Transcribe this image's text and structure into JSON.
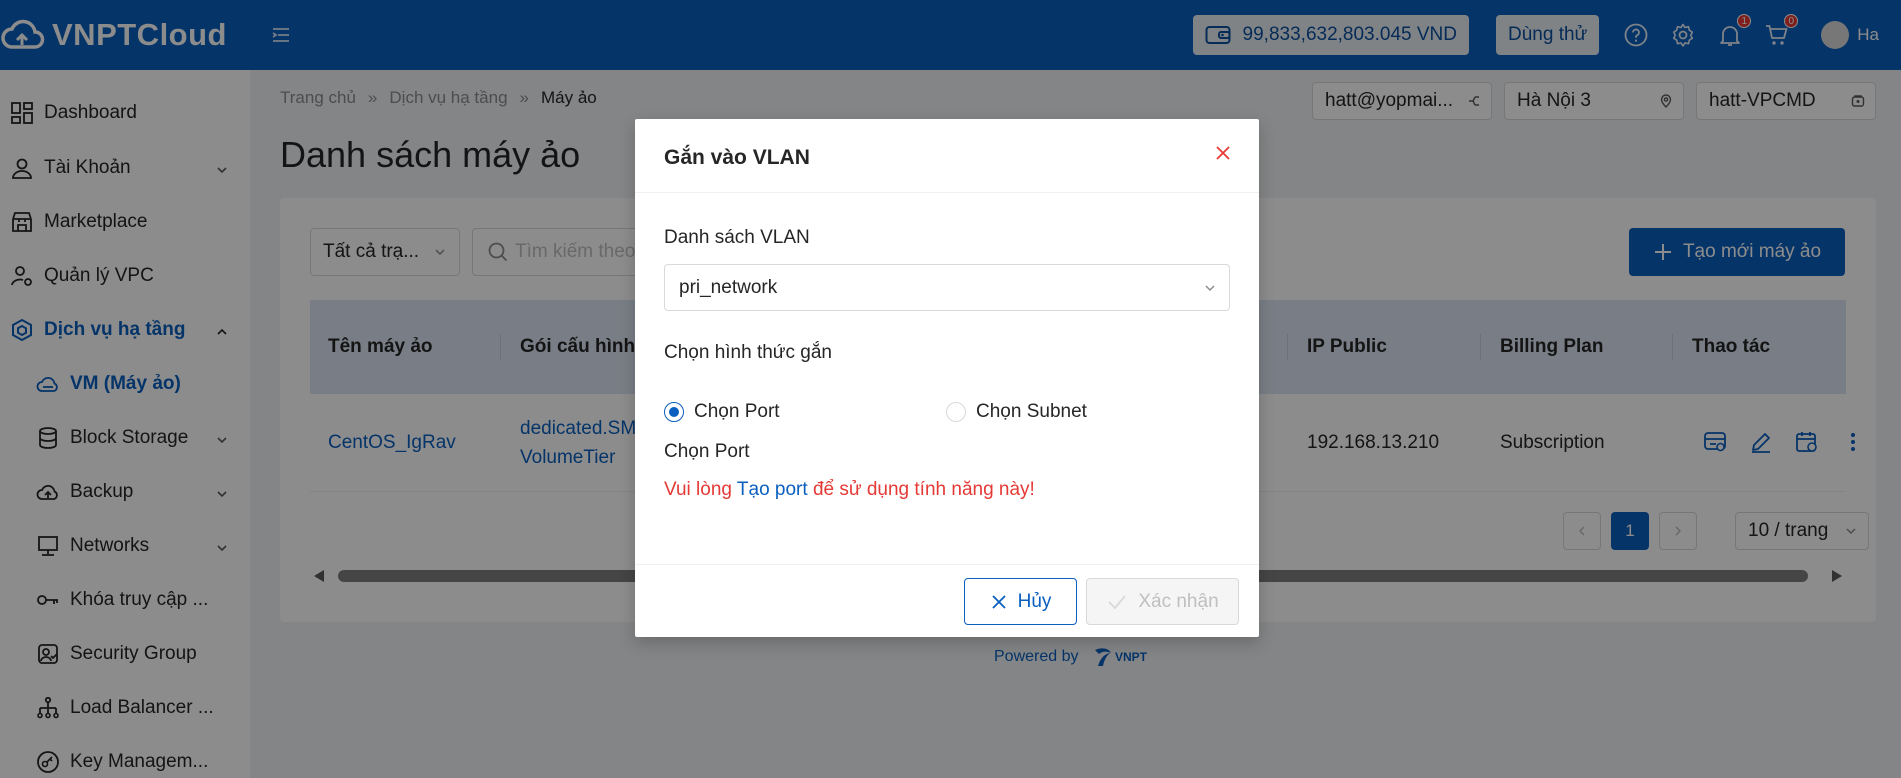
{
  "app": {
    "brand": "VNPTCloud",
    "colors": {
      "primary": "#0a5fbf",
      "danger": "#e53935",
      "header": "#0a5fbf"
    }
  },
  "header": {
    "balance": "99,833,632,803.045 VND",
    "trial_label": "Dùng thử",
    "notifications_count": "1",
    "cart_count": "0",
    "user_name": "Ha"
  },
  "sidebar": {
    "items": [
      {
        "label": "Dashboard",
        "icon": "dashboard-icon"
      },
      {
        "label": "Tài Khoản",
        "icon": "user-icon"
      },
      {
        "label": "Marketplace",
        "icon": "store-icon"
      },
      {
        "label": "Quản lý VPC",
        "icon": "user-settings-icon"
      },
      {
        "label": "Dịch vụ hạ tầng",
        "icon": "cube-icon"
      },
      {
        "label": "VM (Máy ảo)",
        "icon": "cloud-icon"
      },
      {
        "label": "Block Storage",
        "icon": "database-icon"
      },
      {
        "label": "Backup",
        "icon": "cloud-upload-icon"
      },
      {
        "label": "Networks",
        "icon": "monitor-icon"
      },
      {
        "label": "Khóa truy cập ...",
        "icon": "key-icon"
      },
      {
        "label": "Security Group",
        "icon": "security-icon"
      },
      {
        "label": "Load Balancer ...",
        "icon": "sitemap-icon"
      },
      {
        "label": "Key Managem...",
        "icon": "key-circle-icon"
      }
    ]
  },
  "breadcrumb": {
    "home": "Trang chủ",
    "parent": "Dịch vụ hạ tầng",
    "current": "Máy ảo",
    "separator": "»"
  },
  "context": {
    "account": "hatt@yopmai...",
    "region": "Hà Nội 3",
    "vpc": "hatt-VPCMD"
  },
  "page": {
    "title": "Danh sách máy ảo",
    "filter_value": "Tất cả trạ...",
    "search_placeholder": "Tìm kiếm theo",
    "create_label": "Tạo mới máy ảo"
  },
  "table": {
    "columns": [
      "Tên máy ảo",
      "Gói cấu hình",
      "IP Public",
      "Billing Plan",
      "Thao tác"
    ],
    "rows": [
      {
        "name": "CentOS_IgRav",
        "package_line1": "dedicated.SM",
        "package_line2": "VolumeTier",
        "ip_public": "192.168.13.210",
        "billing": "Subscription"
      }
    ]
  },
  "pagination": {
    "current": "1",
    "page_size": "10 / trang"
  },
  "footer": {
    "powered_by": "Powered by",
    "brand": "VNPT"
  },
  "modal": {
    "title": "Gắn vào VLAN",
    "vlan_label": "Danh sách VLAN",
    "vlan_value": "pri_network",
    "attach_type_label": "Chọn hình thức gắn",
    "option_port": "Chọn Port",
    "option_subnet": "Chọn Subnet",
    "port_label": "Chọn Port",
    "warning_prefix": "Vui lòng ",
    "warning_link": "Tạo port",
    "warning_suffix": " để sử dụng tính năng này!",
    "cancel_label": "Hủy",
    "confirm_label": "Xác nhận"
  }
}
